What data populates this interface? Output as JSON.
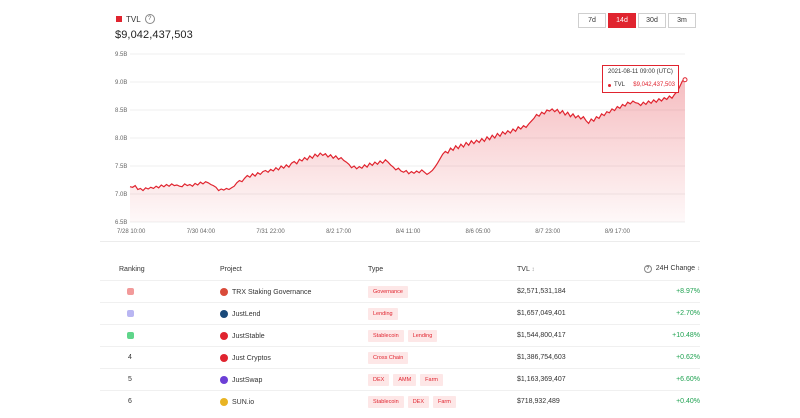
{
  "legend": {
    "label": "TVL",
    "help_icon": "?"
  },
  "total_tvl": "$9,042,437,503",
  "range_buttons": [
    {
      "label": "7d",
      "active": false
    },
    {
      "label": "14d",
      "active": true
    },
    {
      "label": "30d",
      "active": false
    },
    {
      "label": "3m",
      "active": false
    }
  ],
  "colors": {
    "accent": "#e0242f",
    "positive": "#1fa251",
    "tag_bg": "#fde7e7"
  },
  "tooltip": {
    "date": "2021-08-11 09:00 (UTC)",
    "series": "TVL",
    "value": "$9,042,437,503"
  },
  "chart_data": {
    "type": "area",
    "y_ticks": [
      "9.5B",
      "9.0B",
      "8.5B",
      "8.0B",
      "7.5B",
      "7.0B",
      "6.5B"
    ],
    "ylim": [
      6.5,
      9.5
    ],
    "x_ticks": [
      "7/28 10:00",
      "7/30 04:00",
      "7/31 22:00",
      "8/2 17:00",
      "8/4 11:00",
      "8/6 05:00",
      "8/7 23:00",
      "8/9 17:00"
    ],
    "grid": true,
    "series": [
      {
        "values": [
          7.13,
          7.12,
          7.15,
          7.08,
          7.1,
          7.06,
          7.11,
          7.09,
          7.12,
          7.1,
          7.14,
          7.11,
          7.16,
          7.13,
          7.17,
          7.14,
          7.18,
          7.15,
          7.16,
          7.14,
          7.13,
          7.18,
          7.15,
          7.17,
          7.14,
          7.19,
          7.16,
          7.21,
          7.18,
          7.22,
          7.2,
          7.17,
          7.15,
          7.12,
          7.06,
          7.09,
          7.07,
          7.1,
          7.08,
          7.11,
          7.14,
          7.2,
          7.24,
          7.22,
          7.28,
          7.33,
          7.3,
          7.36,
          7.32,
          7.38,
          7.35,
          7.4,
          7.42,
          7.39,
          7.44,
          7.41,
          7.47,
          7.43,
          7.5,
          7.46,
          7.52,
          7.48,
          7.55,
          7.58,
          7.54,
          7.62,
          7.59,
          7.65,
          7.61,
          7.68,
          7.64,
          7.71,
          7.67,
          7.73,
          7.69,
          7.72,
          7.66,
          7.7,
          7.64,
          7.68,
          7.62,
          7.65,
          7.6,
          7.57,
          7.53,
          7.47,
          7.5,
          7.45,
          7.49,
          7.46,
          7.52,
          7.48,
          7.55,
          7.51,
          7.57,
          7.53,
          7.59,
          7.55,
          7.61,
          7.57,
          7.52,
          7.48,
          7.43,
          7.46,
          7.41,
          7.39,
          7.42,
          7.36,
          7.4,
          7.37,
          7.41,
          7.38,
          7.43,
          7.39,
          7.35,
          7.38,
          7.42,
          7.48,
          7.55,
          7.63,
          7.71,
          7.76,
          7.73,
          7.82,
          7.78,
          7.86,
          7.81,
          7.89,
          7.84,
          7.92,
          7.87,
          7.95,
          7.9,
          7.96,
          7.92,
          7.99,
          7.94,
          8.02,
          7.97,
          8.05,
          8.0,
          8.08,
          8.03,
          8.11,
          8.07,
          8.13,
          8.09,
          8.16,
          8.12,
          8.2,
          8.16,
          8.22,
          8.19,
          8.25,
          8.3,
          8.35,
          8.42,
          8.39,
          8.46,
          8.43,
          8.5,
          8.48,
          8.52,
          8.47,
          8.51,
          8.44,
          8.49,
          8.41,
          8.46,
          8.38,
          8.43,
          8.36,
          8.4,
          8.34,
          8.38,
          8.31,
          8.26,
          8.34,
          8.3,
          8.38,
          8.35,
          8.43,
          8.4,
          8.47,
          8.45,
          8.52,
          8.49,
          8.56,
          8.53,
          8.6,
          8.57,
          8.64,
          8.61,
          8.66,
          8.63,
          8.62,
          8.58,
          8.64,
          8.6,
          8.66,
          8.62,
          8.68,
          8.64,
          8.7,
          8.66,
          8.72,
          8.69,
          8.75,
          8.71,
          8.78,
          8.83,
          8.92,
          9.02,
          9.04
        ]
      }
    ]
  },
  "table": {
    "headers": {
      "ranking": "Ranking",
      "project": "Project",
      "type": "Type",
      "tvl": "TVL",
      "tvl_sort": "↕",
      "change": "24H Change",
      "change_help": "?",
      "change_sort": "↕"
    },
    "rows": [
      {
        "rank": "",
        "medal_color": "#f29a9a",
        "project": "TRX Staking Governance",
        "logo_color": "#d94b3a",
        "tags": [
          "Governance"
        ],
        "tvl": "$2,571,531,184",
        "change": "+8.97%"
      },
      {
        "rank": "",
        "medal_color": "#b9b6f2",
        "project": "JustLend",
        "logo_color": "#1a4a7a",
        "tags": [
          "Lending"
        ],
        "tvl": "$1,657,049,401",
        "change": "+2.70%"
      },
      {
        "rank": "",
        "medal_color": "#5fd58a",
        "project": "JustStable",
        "logo_color": "#e0242f",
        "tags": [
          "Stablecoin",
          "Lending"
        ],
        "tvl": "$1,544,800,417",
        "change": "+10.48%"
      },
      {
        "rank": "4",
        "medal_color": "",
        "project": "Just Cryptos",
        "logo_color": "#e0242f",
        "tags": [
          "Cross Chain"
        ],
        "tvl": "$1,386,754,603",
        "change": "+0.62%"
      },
      {
        "rank": "5",
        "medal_color": "",
        "project": "JustSwap",
        "logo_color": "#6c3fd6",
        "tags": [
          "DEX",
          "AMM",
          "Farm"
        ],
        "tvl": "$1,163,369,407",
        "change": "+6.60%"
      },
      {
        "rank": "6",
        "medal_color": "",
        "project": "SUN.io",
        "logo_color": "#e8b424",
        "tags": [
          "Stablecoin",
          "DEX",
          "Farm"
        ],
        "tvl": "$718,932,489",
        "change": "+0.40%"
      }
    ]
  }
}
